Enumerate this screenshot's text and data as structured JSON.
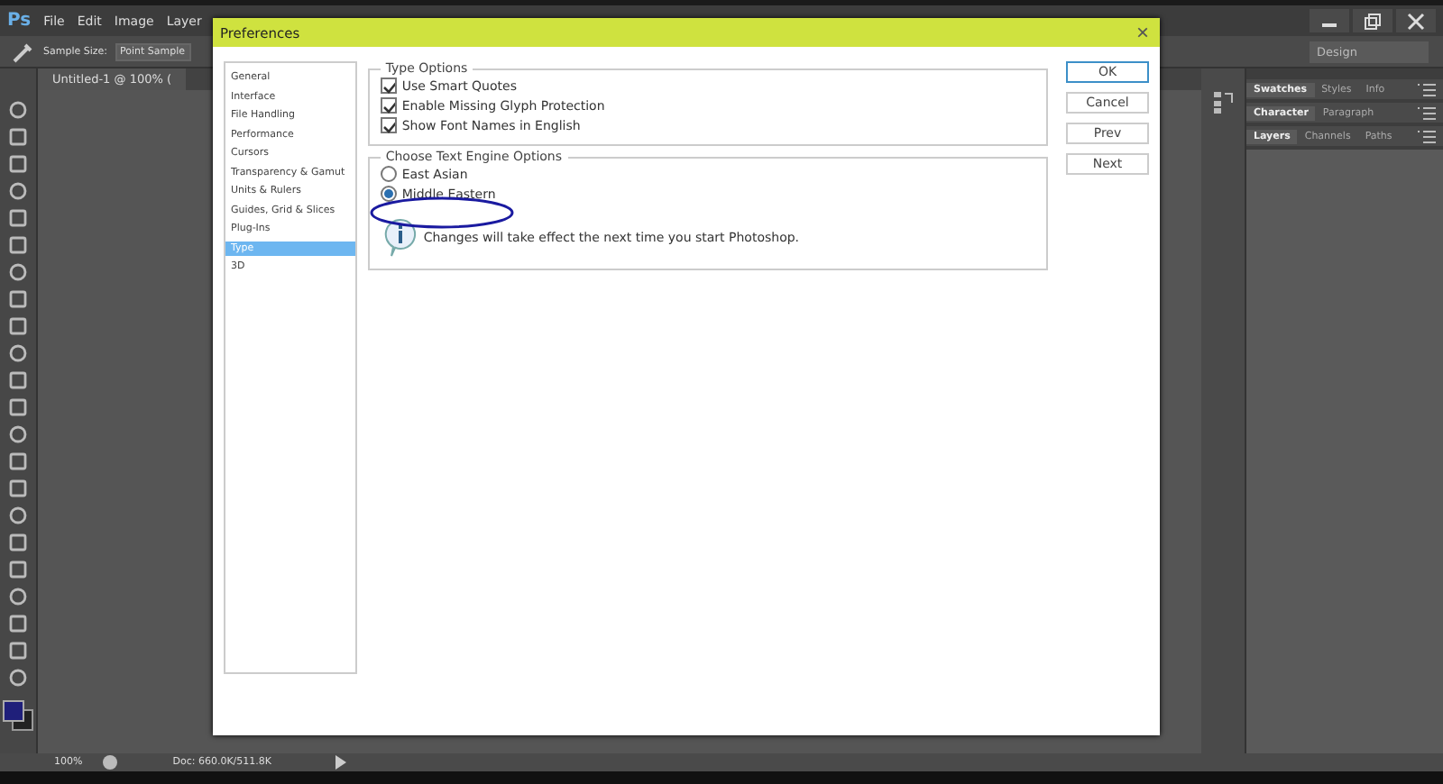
{
  "app": {
    "logo": "Ps",
    "menu": [
      "File",
      "Edit",
      "Image",
      "Layer"
    ],
    "options": {
      "sample_label": "Sample Size:",
      "sample_value": "Point Sample"
    },
    "document_tab": "Untitled-1 @ 100% (",
    "workspace": "Design",
    "panel_groups": [
      {
        "tabs": [
          {
            "label": "Swatches",
            "selected": true
          },
          {
            "label": "Styles",
            "selected": false
          },
          {
            "label": "Info",
            "selected": false
          }
        ]
      },
      {
        "tabs": [
          {
            "label": "Character",
            "selected": true
          },
          {
            "label": "Paragraph",
            "selected": false
          }
        ]
      },
      {
        "tabs": [
          {
            "label": "Layers",
            "selected": true
          },
          {
            "label": "Channels",
            "selected": false
          },
          {
            "label": "Paths",
            "selected": false
          }
        ]
      }
    ],
    "status_bar": {
      "zoom": "100%",
      "doc": "Doc: 660.0K/511.8K"
    }
  },
  "dialog": {
    "title": "Preferences",
    "close": "×",
    "sidebar": [
      {
        "label": "General",
        "selected": false
      },
      {
        "label": "Interface",
        "selected": false
      },
      {
        "label": "File Handling",
        "selected": false
      },
      {
        "label": "Performance",
        "selected": false
      },
      {
        "label": "Cursors",
        "selected": false
      },
      {
        "label": "Transparency & Gamut",
        "selected": false
      },
      {
        "label": "Units & Rulers",
        "selected": false
      },
      {
        "label": "Guides, Grid & Slices",
        "selected": false
      },
      {
        "label": "Plug-Ins",
        "selected": false
      },
      {
        "label": "Type",
        "selected": true
      },
      {
        "label": "3D",
        "selected": false
      }
    ],
    "type_options": {
      "title": "Type Options",
      "items": [
        {
          "label": "Use Smart Quotes",
          "checked": true
        },
        {
          "label": "Enable Missing Glyph Protection",
          "checked": true
        },
        {
          "label": "Show Font Names in English",
          "checked": true
        }
      ]
    },
    "engine_options": {
      "title": "Choose Text Engine Options",
      "items": [
        {
          "label": "East Asian",
          "selected": false
        },
        {
          "label": "Middle Eastern",
          "selected": true
        }
      ],
      "note": "Changes will take effect the next time you start Photoshop."
    },
    "buttons": [
      {
        "label": "OK",
        "default": true
      },
      {
        "label": "Cancel",
        "default": false
      },
      {
        "label": "Prev",
        "default": false
      },
      {
        "label": "Next",
        "default": false
      }
    ]
  }
}
